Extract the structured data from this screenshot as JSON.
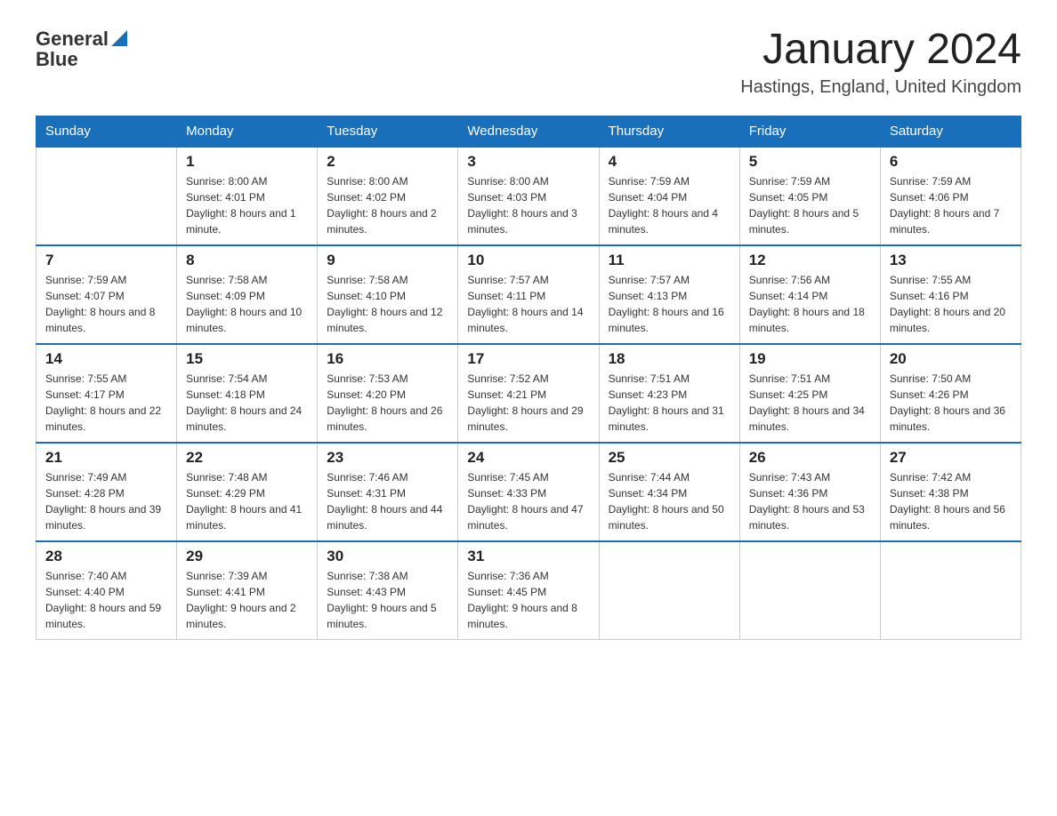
{
  "header": {
    "logo_general": "General",
    "logo_blue": "Blue",
    "month_title": "January 2024",
    "location": "Hastings, England, United Kingdom"
  },
  "days_of_week": [
    "Sunday",
    "Monday",
    "Tuesday",
    "Wednesday",
    "Thursday",
    "Friday",
    "Saturday"
  ],
  "weeks": [
    [
      {
        "num": "",
        "sunrise": "",
        "sunset": "",
        "daylight": ""
      },
      {
        "num": "1",
        "sunrise": "Sunrise: 8:00 AM",
        "sunset": "Sunset: 4:01 PM",
        "daylight": "Daylight: 8 hours and 1 minute."
      },
      {
        "num": "2",
        "sunrise": "Sunrise: 8:00 AM",
        "sunset": "Sunset: 4:02 PM",
        "daylight": "Daylight: 8 hours and 2 minutes."
      },
      {
        "num": "3",
        "sunrise": "Sunrise: 8:00 AM",
        "sunset": "Sunset: 4:03 PM",
        "daylight": "Daylight: 8 hours and 3 minutes."
      },
      {
        "num": "4",
        "sunrise": "Sunrise: 7:59 AM",
        "sunset": "Sunset: 4:04 PM",
        "daylight": "Daylight: 8 hours and 4 minutes."
      },
      {
        "num": "5",
        "sunrise": "Sunrise: 7:59 AM",
        "sunset": "Sunset: 4:05 PM",
        "daylight": "Daylight: 8 hours and 5 minutes."
      },
      {
        "num": "6",
        "sunrise": "Sunrise: 7:59 AM",
        "sunset": "Sunset: 4:06 PM",
        "daylight": "Daylight: 8 hours and 7 minutes."
      }
    ],
    [
      {
        "num": "7",
        "sunrise": "Sunrise: 7:59 AM",
        "sunset": "Sunset: 4:07 PM",
        "daylight": "Daylight: 8 hours and 8 minutes."
      },
      {
        "num": "8",
        "sunrise": "Sunrise: 7:58 AM",
        "sunset": "Sunset: 4:09 PM",
        "daylight": "Daylight: 8 hours and 10 minutes."
      },
      {
        "num": "9",
        "sunrise": "Sunrise: 7:58 AM",
        "sunset": "Sunset: 4:10 PM",
        "daylight": "Daylight: 8 hours and 12 minutes."
      },
      {
        "num": "10",
        "sunrise": "Sunrise: 7:57 AM",
        "sunset": "Sunset: 4:11 PM",
        "daylight": "Daylight: 8 hours and 14 minutes."
      },
      {
        "num": "11",
        "sunrise": "Sunrise: 7:57 AM",
        "sunset": "Sunset: 4:13 PM",
        "daylight": "Daylight: 8 hours and 16 minutes."
      },
      {
        "num": "12",
        "sunrise": "Sunrise: 7:56 AM",
        "sunset": "Sunset: 4:14 PM",
        "daylight": "Daylight: 8 hours and 18 minutes."
      },
      {
        "num": "13",
        "sunrise": "Sunrise: 7:55 AM",
        "sunset": "Sunset: 4:16 PM",
        "daylight": "Daylight: 8 hours and 20 minutes."
      }
    ],
    [
      {
        "num": "14",
        "sunrise": "Sunrise: 7:55 AM",
        "sunset": "Sunset: 4:17 PM",
        "daylight": "Daylight: 8 hours and 22 minutes."
      },
      {
        "num": "15",
        "sunrise": "Sunrise: 7:54 AM",
        "sunset": "Sunset: 4:18 PM",
        "daylight": "Daylight: 8 hours and 24 minutes."
      },
      {
        "num": "16",
        "sunrise": "Sunrise: 7:53 AM",
        "sunset": "Sunset: 4:20 PM",
        "daylight": "Daylight: 8 hours and 26 minutes."
      },
      {
        "num": "17",
        "sunrise": "Sunrise: 7:52 AM",
        "sunset": "Sunset: 4:21 PM",
        "daylight": "Daylight: 8 hours and 29 minutes."
      },
      {
        "num": "18",
        "sunrise": "Sunrise: 7:51 AM",
        "sunset": "Sunset: 4:23 PM",
        "daylight": "Daylight: 8 hours and 31 minutes."
      },
      {
        "num": "19",
        "sunrise": "Sunrise: 7:51 AM",
        "sunset": "Sunset: 4:25 PM",
        "daylight": "Daylight: 8 hours and 34 minutes."
      },
      {
        "num": "20",
        "sunrise": "Sunrise: 7:50 AM",
        "sunset": "Sunset: 4:26 PM",
        "daylight": "Daylight: 8 hours and 36 minutes."
      }
    ],
    [
      {
        "num": "21",
        "sunrise": "Sunrise: 7:49 AM",
        "sunset": "Sunset: 4:28 PM",
        "daylight": "Daylight: 8 hours and 39 minutes."
      },
      {
        "num": "22",
        "sunrise": "Sunrise: 7:48 AM",
        "sunset": "Sunset: 4:29 PM",
        "daylight": "Daylight: 8 hours and 41 minutes."
      },
      {
        "num": "23",
        "sunrise": "Sunrise: 7:46 AM",
        "sunset": "Sunset: 4:31 PM",
        "daylight": "Daylight: 8 hours and 44 minutes."
      },
      {
        "num": "24",
        "sunrise": "Sunrise: 7:45 AM",
        "sunset": "Sunset: 4:33 PM",
        "daylight": "Daylight: 8 hours and 47 minutes."
      },
      {
        "num": "25",
        "sunrise": "Sunrise: 7:44 AM",
        "sunset": "Sunset: 4:34 PM",
        "daylight": "Daylight: 8 hours and 50 minutes."
      },
      {
        "num": "26",
        "sunrise": "Sunrise: 7:43 AM",
        "sunset": "Sunset: 4:36 PM",
        "daylight": "Daylight: 8 hours and 53 minutes."
      },
      {
        "num": "27",
        "sunrise": "Sunrise: 7:42 AM",
        "sunset": "Sunset: 4:38 PM",
        "daylight": "Daylight: 8 hours and 56 minutes."
      }
    ],
    [
      {
        "num": "28",
        "sunrise": "Sunrise: 7:40 AM",
        "sunset": "Sunset: 4:40 PM",
        "daylight": "Daylight: 8 hours and 59 minutes."
      },
      {
        "num": "29",
        "sunrise": "Sunrise: 7:39 AM",
        "sunset": "Sunset: 4:41 PM",
        "daylight": "Daylight: 9 hours and 2 minutes."
      },
      {
        "num": "30",
        "sunrise": "Sunrise: 7:38 AM",
        "sunset": "Sunset: 4:43 PM",
        "daylight": "Daylight: 9 hours and 5 minutes."
      },
      {
        "num": "31",
        "sunrise": "Sunrise: 7:36 AM",
        "sunset": "Sunset: 4:45 PM",
        "daylight": "Daylight: 9 hours and 8 minutes."
      },
      {
        "num": "",
        "sunrise": "",
        "sunset": "",
        "daylight": ""
      },
      {
        "num": "",
        "sunrise": "",
        "sunset": "",
        "daylight": ""
      },
      {
        "num": "",
        "sunrise": "",
        "sunset": "",
        "daylight": ""
      }
    ]
  ]
}
